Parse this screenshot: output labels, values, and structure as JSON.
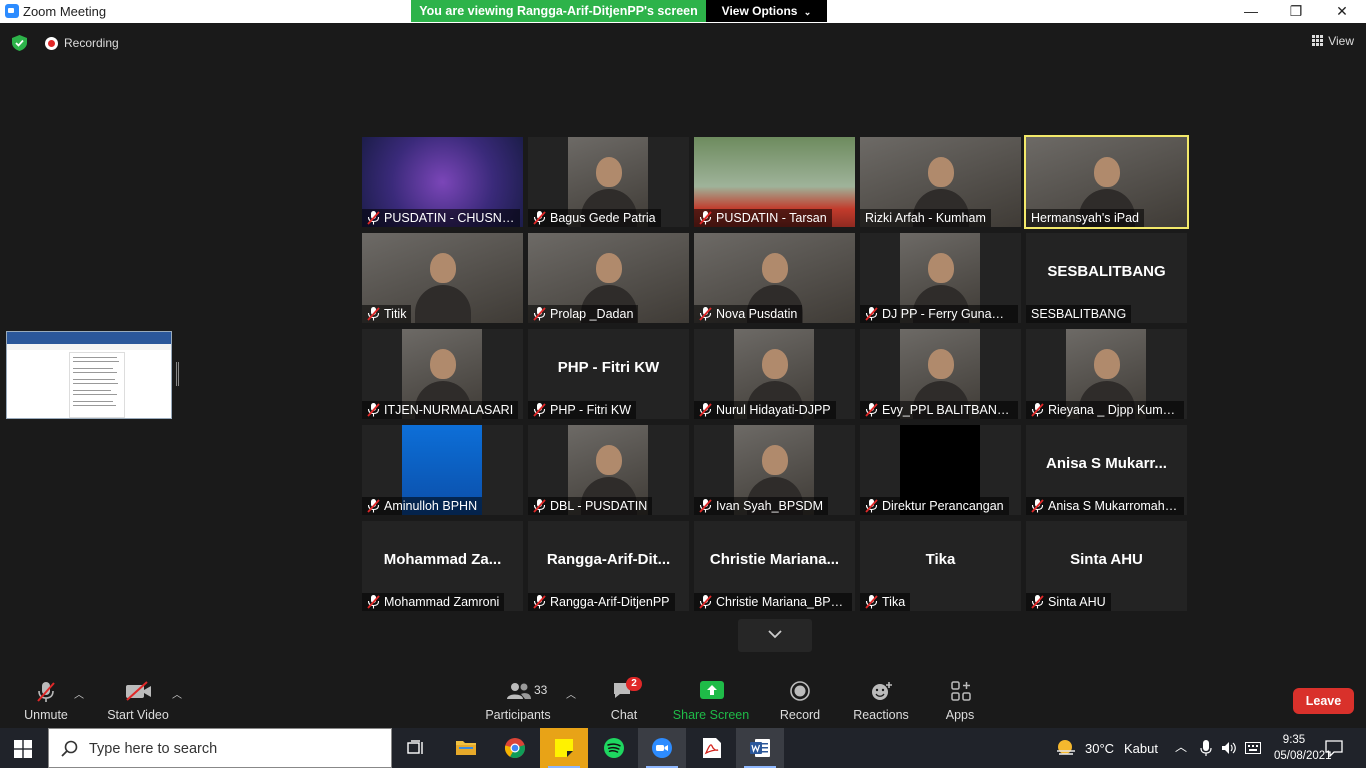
{
  "window": {
    "title": "Zoom Meeting",
    "controls": [
      "—",
      "❐",
      "✕"
    ]
  },
  "share_banner": {
    "text": "You are viewing Rangga-Arif-DitjenPP's screen",
    "view_options_label": "View Options"
  },
  "topbar": {
    "recording_label": "Recording",
    "view_label": "View"
  },
  "participants": [
    {
      "label": "PUSDATIN - CHUSNI ...",
      "muted": true,
      "video": "pusdatin-logo"
    },
    {
      "label": "Bagus Gede Patria",
      "muted": true,
      "video": "person"
    },
    {
      "label": "PUSDATIN - Tarsan",
      "muted": true,
      "video": "building"
    },
    {
      "label": "Rizki Arfah - Kumham",
      "muted": false,
      "video": "person"
    },
    {
      "label": "Hermansyah's iPad",
      "muted": false,
      "video": "person",
      "active_speaker": true
    },
    {
      "label": "Titik",
      "muted": true,
      "video": "person"
    },
    {
      "label": "Prolap _Dadan",
      "muted": true,
      "video": "person"
    },
    {
      "label": "Nova Pusdatin",
      "muted": true,
      "video": "person"
    },
    {
      "label": "DJ PP - Ferry Gunawa...",
      "muted": true,
      "video": "person"
    },
    {
      "label": "SESBALITBANG",
      "muted": false,
      "video": "none",
      "display_name": "SESBALITBANG"
    },
    {
      "label": "ITJEN-NURMALASARI",
      "muted": true,
      "video": "person"
    },
    {
      "label": "PHP - Fitri KW",
      "muted": true,
      "video": "none",
      "display_name": "PHP - Fitri KW"
    },
    {
      "label": "Nurul Hidayati-DJPP",
      "muted": true,
      "video": "person"
    },
    {
      "label": "Evy_PPL BALITBANG H...",
      "muted": true,
      "video": "person"
    },
    {
      "label": "Rieyana _ Djpp Kumh...",
      "muted": true,
      "video": "person"
    },
    {
      "label": "Aminulloh BPHN",
      "muted": true,
      "video": "bphn-logo"
    },
    {
      "label": "DBL - PUSDATIN",
      "muted": true,
      "video": "person"
    },
    {
      "label": "Ivan Syah_BPSDM",
      "muted": true,
      "video": "person"
    },
    {
      "label": "Direktur Perancangan",
      "muted": true,
      "video": "pengayoman-logo"
    },
    {
      "label": "Anisa S Mukarromah_...",
      "muted": true,
      "video": "none",
      "display_name": "Anisa S Mukarr..."
    },
    {
      "label": "Mohammad Zamroni",
      "muted": true,
      "video": "none",
      "display_name": "Mohammad  Za..."
    },
    {
      "label": "Rangga-Arif-DitjenPP",
      "muted": true,
      "video": "none",
      "display_name": "Rangga-Arif-Dit..."
    },
    {
      "label": "Christie Mariana_BPS...",
      "muted": true,
      "video": "none",
      "display_name": "Christie  Mariana..."
    },
    {
      "label": "Tika",
      "muted": true,
      "video": "none",
      "display_name": "Tika"
    },
    {
      "label": "Sinta AHU",
      "muted": true,
      "video": "none",
      "display_name": "Sinta AHU"
    }
  ],
  "toolbar": {
    "unmute": "Unmute",
    "start_video": "Start Video",
    "participants": "Participants",
    "participants_count": "33",
    "chat": "Chat",
    "chat_badge": "2",
    "share_screen": "Share Screen",
    "record": "Record",
    "reactions": "Reactions",
    "apps": "Apps",
    "leave": "Leave"
  },
  "taskbar": {
    "search_placeholder": "Type here to search",
    "weather_temp": "30°C",
    "weather_desc": "Kabut",
    "time": "9:35",
    "date": "05/08/2021"
  },
  "colors": {
    "share_banner": "#2db34a",
    "active_speaker": "#f3e96a",
    "leave": "#d9312b",
    "share_screen_icon": "#1fbb48"
  }
}
